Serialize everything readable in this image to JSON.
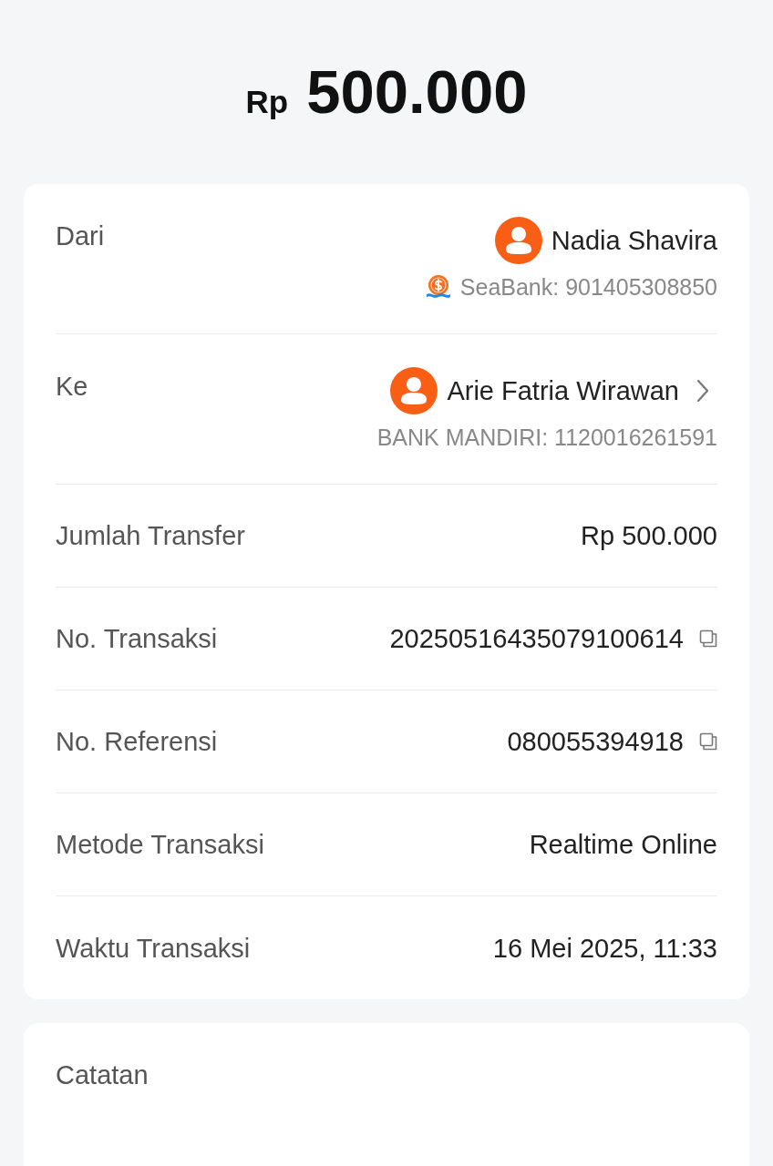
{
  "amount": {
    "currency": "Rp",
    "value": "500.000"
  },
  "details": [
    {
      "kind": "party",
      "label": "Dari",
      "name": "Nadia Shavira",
      "account": "SeaBank: 901405308850",
      "bank_logo": true,
      "chevron": false
    },
    {
      "kind": "party",
      "label": "Ke",
      "name": "Arie Fatria Wirawan",
      "account": "BANK MANDIRI: 1120016261591",
      "bank_logo": false,
      "chevron": true
    },
    {
      "kind": "value",
      "label": "Jumlah Transfer",
      "value": "Rp 500.000",
      "copyable": false
    },
    {
      "kind": "value",
      "label": "No. Transaksi",
      "value": "20250516435079100614",
      "copyable": true
    },
    {
      "kind": "value",
      "label": "No. Referensi",
      "value": "080055394918",
      "copyable": true
    },
    {
      "kind": "value",
      "label": "Metode Transaksi",
      "value": "Realtime Online",
      "copyable": false
    },
    {
      "kind": "value",
      "label": "Waktu Transaksi",
      "value": "16 Mei 2025, 11:33",
      "copyable": false
    }
  ],
  "notes": {
    "label": "Catatan"
  }
}
